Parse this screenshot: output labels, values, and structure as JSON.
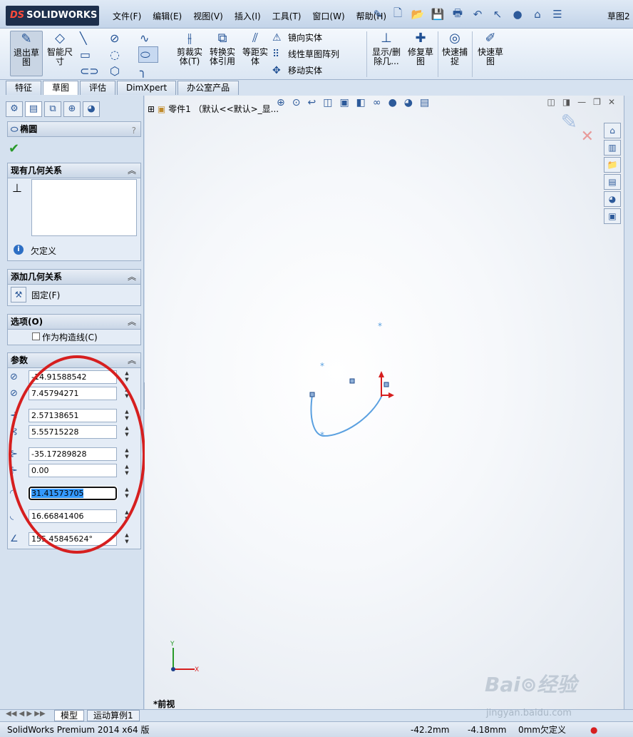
{
  "app": {
    "logo_text": "SOLIDWORKS",
    "menus": [
      "文件(F)",
      "编辑(E)",
      "视图(V)",
      "插入(I)",
      "工具(T)",
      "窗口(W)",
      "帮助(H)"
    ],
    "document_title": "草图2"
  },
  "ribbon": {
    "exit_sketch": "退出草图",
    "smart_dimension": "智能尺寸",
    "trim": "剪裁实体(T)",
    "convert": "转换实体引用",
    "offset": "等距实体",
    "mirror": "镜向实体",
    "linear_pattern": "线性草图阵列",
    "move": "移动实体",
    "show_delete": "显示/删除几...",
    "repair": "修复草图",
    "quick_snap": "快速捕捉",
    "rapid_sketch": "快速草图"
  },
  "command_tabs": [
    "特征",
    "草图",
    "评估",
    "DimXpert",
    "办公室产品"
  ],
  "property_manager": {
    "title": "椭圆",
    "existing_relations": {
      "header": "现有几何关系",
      "status": "欠定义"
    },
    "add_relations": {
      "header": "添加几何关系",
      "fix": "固定(F)"
    },
    "options": {
      "header": "选项(O)",
      "construction": "作为构造线(C)"
    },
    "parameters": {
      "header": "参数",
      "center_x": "-14.91588542",
      "center_y": "7.45794271",
      "start_x": "2.57138651",
      "start_y": "5.55715228",
      "end_x": "-35.17289828",
      "end_y": "0.00",
      "radius1": "31.41573705",
      "radius2": "16.66841406",
      "angle": "155.45845624°"
    }
  },
  "canvas": {
    "feature_tree_label": "零件1 （默认<<默认>_显...",
    "view_name": "*前视"
  },
  "bottom_tabs": [
    "模型",
    "运动算例1"
  ],
  "status": {
    "product": "SolidWorks Premium 2014 x64 版",
    "x": "-42.2mm",
    "y": "-4.18mm",
    "z": "0mm",
    "state": "欠定义"
  },
  "watermark": {
    "main": "Bai⊚经验",
    "sub": "jingyan.baidu.com"
  },
  "colors": {
    "highlight": "#3399ff",
    "annotation_red": "#d61f1f",
    "sketch_curve": "#5aa0e0"
  }
}
